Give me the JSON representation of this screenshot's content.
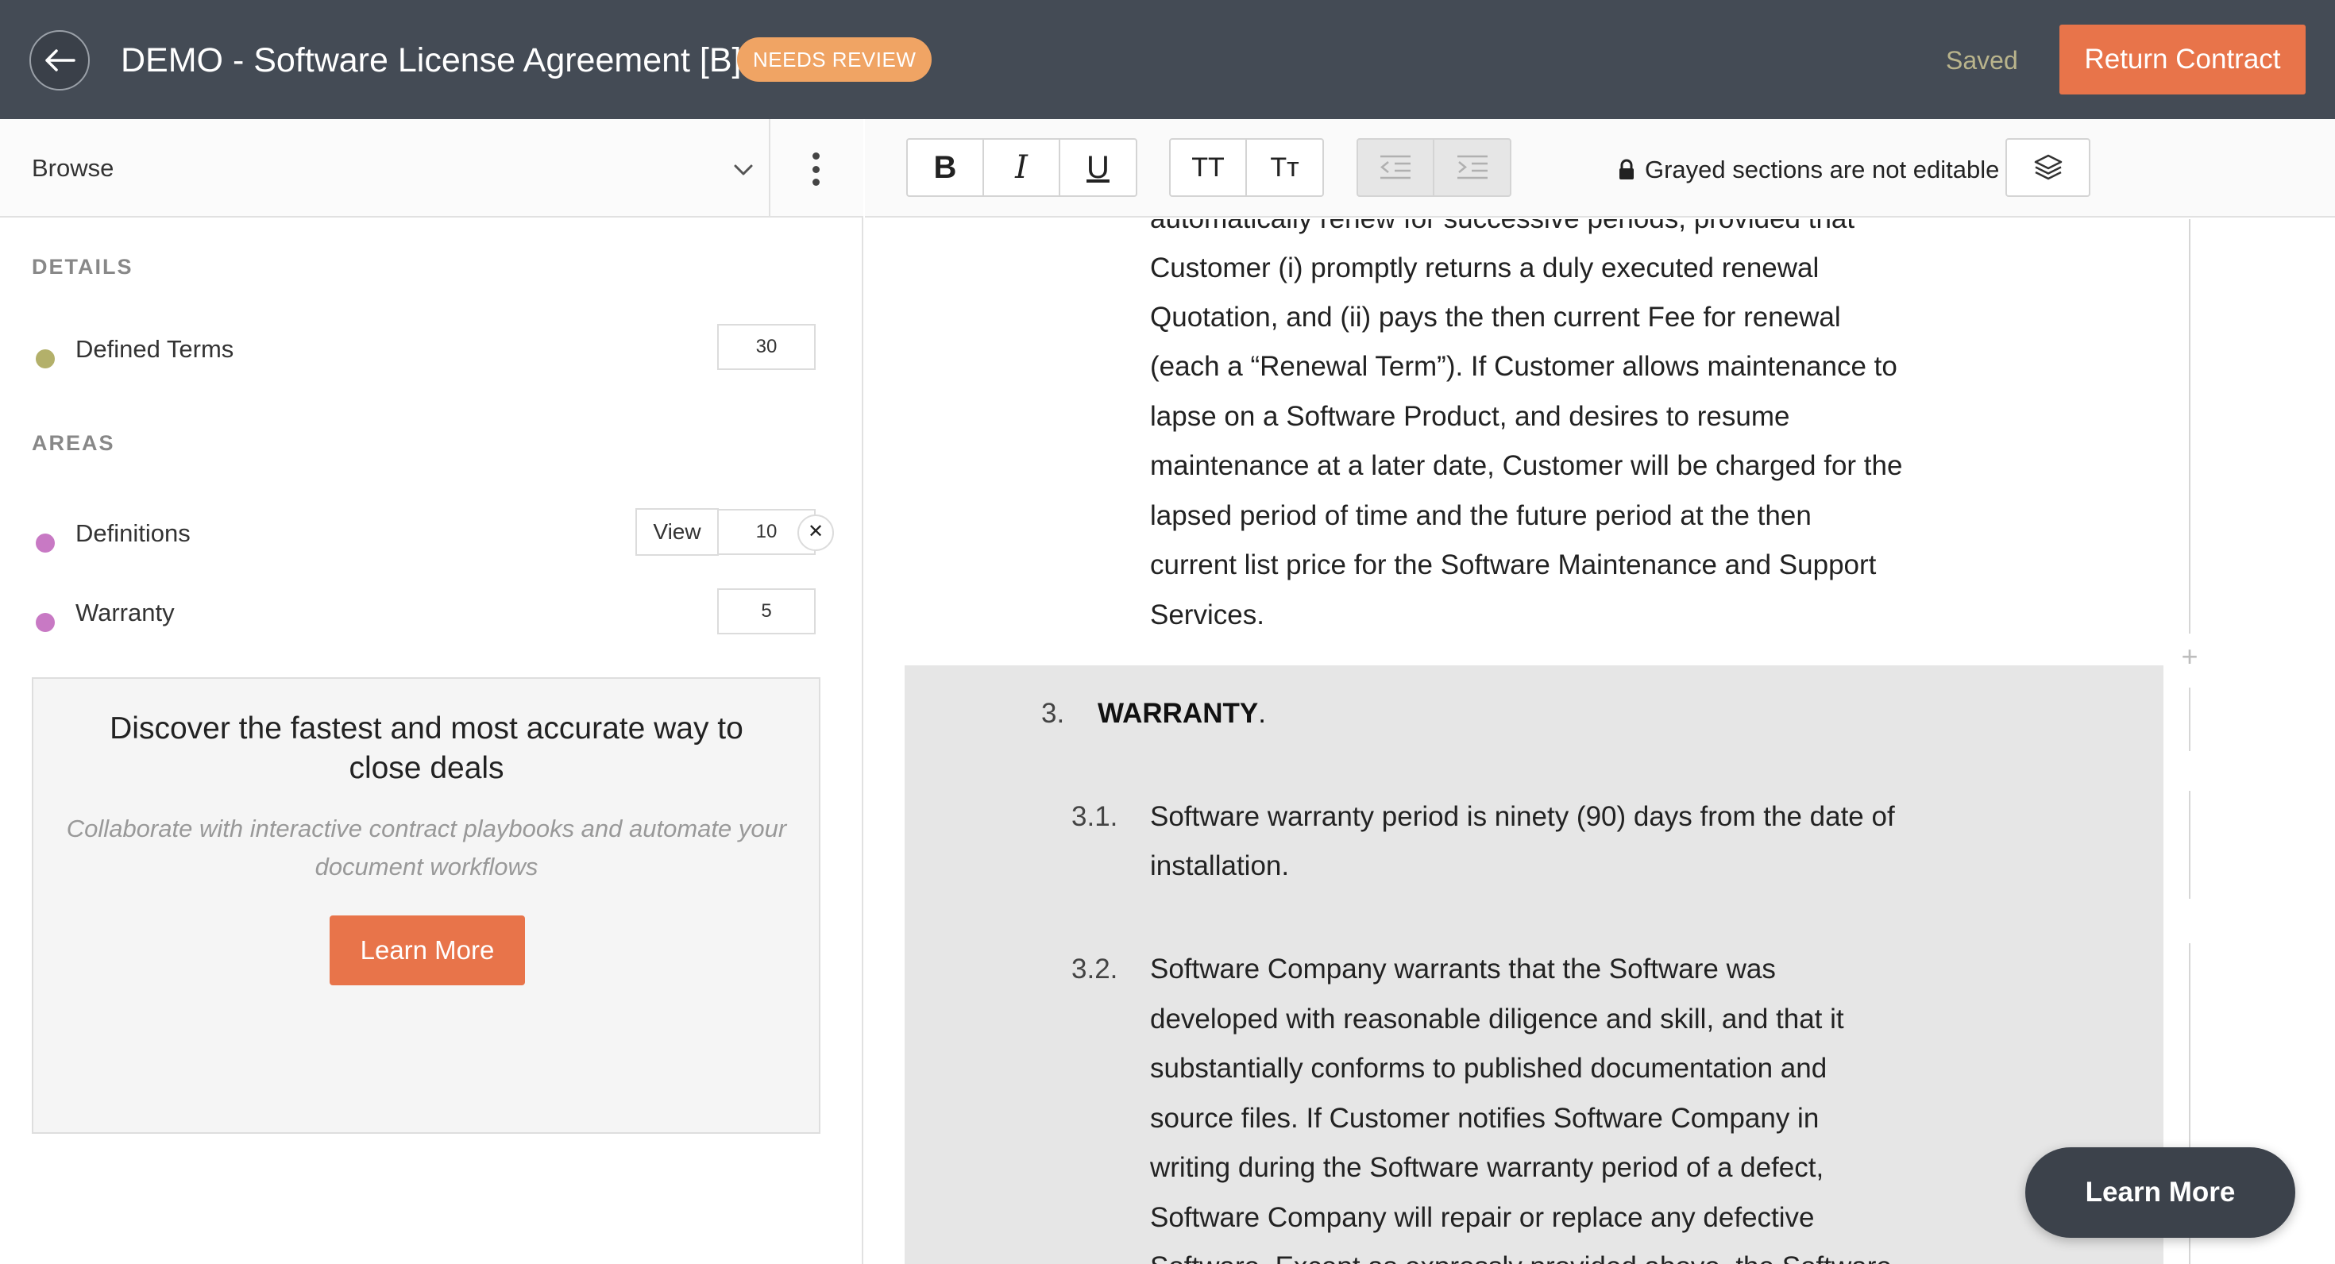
{
  "header": {
    "title": "DEMO - Software License Agreement [B]",
    "status_badge": "NEEDS REVIEW",
    "save_state": "Saved",
    "return_button": "Return Contract"
  },
  "sidebar": {
    "browse_label": "Browse",
    "details_heading": "DETAILS",
    "details": [
      {
        "label": "Defined Terms",
        "count": "30",
        "color": "#b3b06a"
      }
    ],
    "areas_heading": "AREAS",
    "areas": [
      {
        "label": "Definitions",
        "count": "10",
        "view_label": "View",
        "close_label": "✕",
        "color": "#c879c4"
      },
      {
        "label": "Warranty",
        "count": "5",
        "color": "#c879c4"
      }
    ],
    "promo": {
      "title": "Discover the fastest and most accurate way to close deals",
      "subtitle": "Collaborate with interactive contract playbooks and automate your document workflows",
      "button": "Learn More"
    }
  },
  "toolbar": {
    "bold": "B",
    "italic": "I",
    "underline": "U",
    "uppercase": "TT",
    "titlecase": "Tт",
    "lock_note": "Grayed sections are not editable"
  },
  "document": {
    "partial_line": "automatically renew for successive periods, provided that",
    "lines_editable": [
      "Customer (i) promptly returns a duly executed renewal",
      "Quotation, and (ii) pays the then current Fee for renewal",
      "(each a “Renewal Term”).  If Customer allows maintenance to",
      "lapse on a Software Product, and desires to resume",
      "maintenance at a later date, Customer will be charged for the",
      "lapsed period of time and the future period at the then",
      "current list price for the Software Maintenance and Support",
      "Services."
    ],
    "section_number": "3.",
    "section_title": "WARRANTY",
    "section_title_suffix": ".",
    "clauses": [
      {
        "number": "3.1.",
        "lines": [
          "Software warranty period is ninety (90) days from the date of",
          "installation."
        ]
      },
      {
        "number": "3.2.",
        "lines": [
          "Software Company warrants that the Software was",
          "developed with reasonable diligence and skill, and that it",
          "substantially conforms to published documentation and",
          "source files.  If Customer notifies Software Company in",
          "writing during the Software warranty period of a defect,",
          "Software Company will repair or replace any defective",
          "Software. Except as expressly provided above, the Software"
        ]
      }
    ]
  },
  "fab": {
    "label": "Learn More"
  },
  "colors": {
    "header_bg": "#444b55",
    "accent": "#e8744a",
    "badge": "#f0a464",
    "grayed_section": "#e6e6e6"
  }
}
